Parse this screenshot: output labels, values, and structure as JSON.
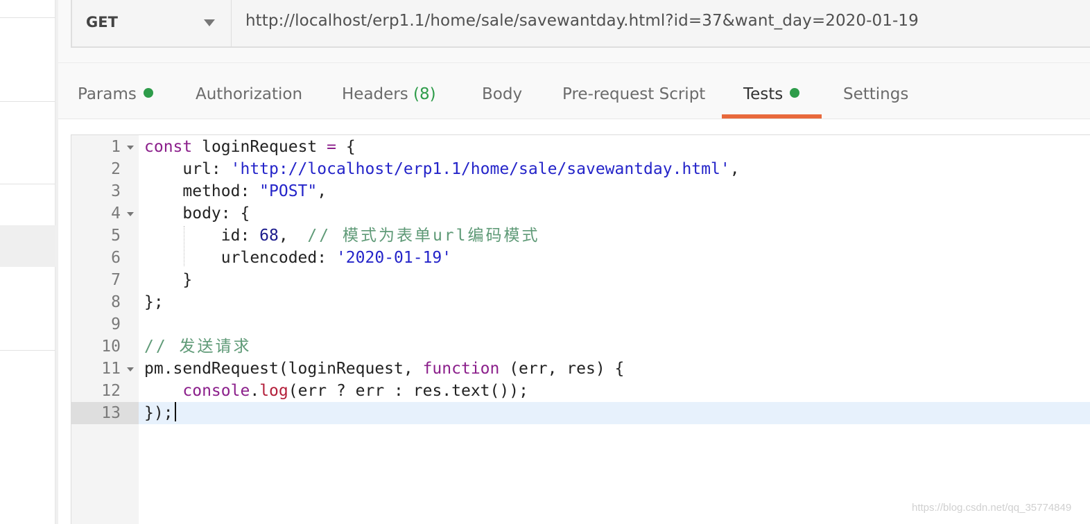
{
  "request": {
    "method": "GET",
    "url": "http://localhost/erp1.1/home/sale/savewantday.html?id=37&want_day=2020-01-19"
  },
  "tabs": [
    {
      "label": "Params",
      "has_dot": true
    },
    {
      "label": "Authorization"
    },
    {
      "label": "Headers",
      "count": "(8)"
    },
    {
      "label": "Body"
    },
    {
      "label": "Pre-request Script"
    },
    {
      "label": "Tests",
      "has_dot": true,
      "active": true
    },
    {
      "label": "Settings"
    }
  ],
  "editor": {
    "line_numbers": [
      "1",
      "2",
      "3",
      "4",
      "5",
      "6",
      "7",
      "8",
      "9",
      "10",
      "11",
      "12",
      "13"
    ],
    "lines": [
      [
        "const",
        " loginRequest ",
        "=",
        " {"
      ],
      [
        "    url: ",
        "'http://localhost/erp1.1/home/sale/savewantday.html'",
        ","
      ],
      [
        "    method: ",
        "\"POST\"",
        ","
      ],
      [
        "    body: {"
      ],
      [
        "        id: ",
        "68",
        ",  ",
        "// 模式为表单url编码模式"
      ],
      [
        "        urlencoded: ",
        "'2020-01-19'"
      ],
      [
        "    }"
      ],
      [
        "};"
      ],
      [
        ""
      ],
      [
        "// 发送请求"
      ],
      [
        "pm.sendRequest(loginRequest, ",
        "function",
        " (err, res) {"
      ],
      [
        "    ",
        "console",
        ".",
        "log",
        "(err ? err : res.text());"
      ],
      [
        "});"
      ]
    ],
    "current_line": "13"
  },
  "watermark": "https://blog.csdn.net/qq_35774849",
  "colors": {
    "accent_tab": "#e8693c",
    "dot_green": "#2e9c4a",
    "keyword": "#8b1f8b",
    "string": "#2424c9",
    "comment": "#5f9a77"
  }
}
